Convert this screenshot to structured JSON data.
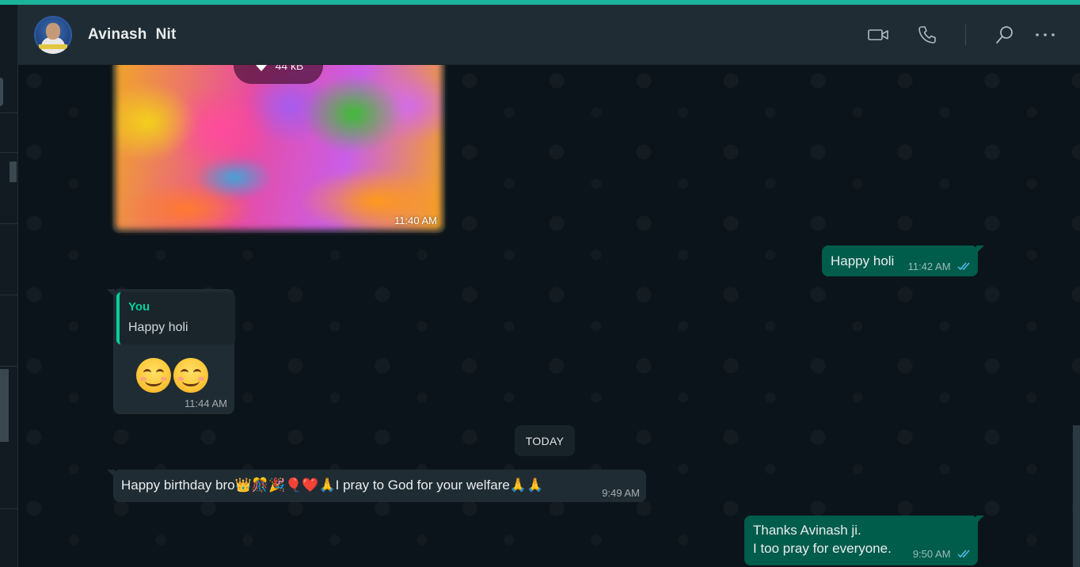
{
  "header": {
    "contact_name": "Avinash  Nit",
    "icons": [
      "video-call-icon",
      "voice-call-icon",
      "search-icon",
      "more-options-icon"
    ]
  },
  "colors": {
    "accent_stripe": "#1ab39b",
    "outgoing_bubble": "#005c4b",
    "incoming_bubble": "#202c33",
    "read_ticks": "#53bdeb",
    "quote_accent": "#06cf9c"
  },
  "messages": {
    "image": {
      "download_size": "44 kB",
      "time": "11:40 AM"
    },
    "out1": {
      "text": "Happy holi",
      "time": "11:42 AM"
    },
    "reply": {
      "quote_author": "You",
      "quote_text": "Happy holi",
      "content": "😊😊",
      "time": "11:44 AM"
    },
    "date_divider": "TODAY",
    "in2": {
      "text_before": "Happy birthday bro",
      "emojis": "👑🎊🎉🎈❤️🙏",
      "text_after": "I pray to God for your welfare",
      "emojis_end": "🙏🙏",
      "time": "9:49 AM"
    },
    "out2": {
      "line1": "Thanks Avinash ji.",
      "line2": "I too pray for everyone.",
      "time": "9:50 AM"
    }
  }
}
